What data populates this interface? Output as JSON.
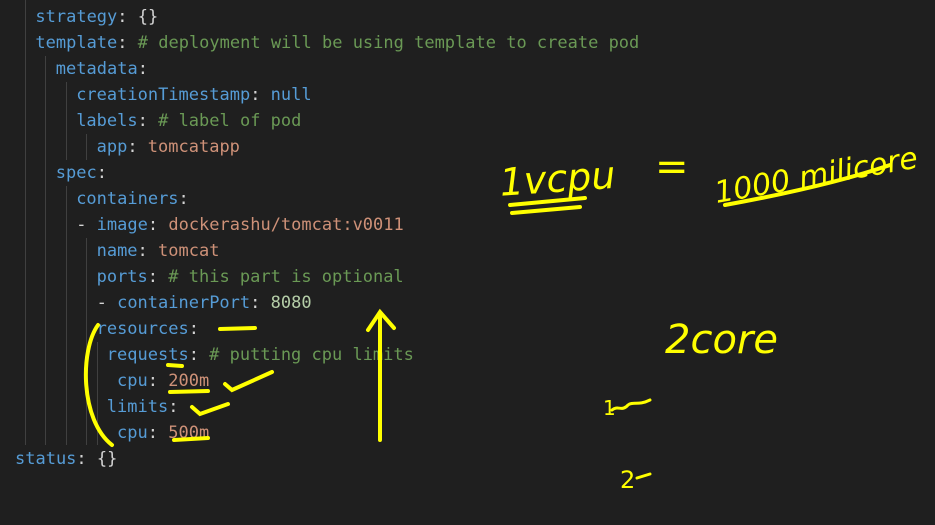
{
  "editor": {
    "lines": [
      {
        "indent": 2,
        "key": "strategy",
        "sep": ": ",
        "value": "{}",
        "value_type": "punct",
        "comment": ""
      },
      {
        "indent": 2,
        "key": "template",
        "sep": ": ",
        "value": "",
        "value_type": "",
        "comment": "# deployment will be using template to create pod"
      },
      {
        "indent": 4,
        "key": "metadata",
        "sep": ":",
        "value": "",
        "value_type": "",
        "comment": ""
      },
      {
        "indent": 6,
        "key": "creationTimestamp",
        "sep": ": ",
        "value": "null",
        "value_type": "kw",
        "comment": ""
      },
      {
        "indent": 6,
        "key": "labels",
        "sep": ": ",
        "value": "",
        "value_type": "",
        "comment": "# label of pod"
      },
      {
        "indent": 8,
        "key": "app",
        "sep": ": ",
        "value": "tomcatapp",
        "value_type": "str",
        "comment": ""
      },
      {
        "indent": 4,
        "key": "spec",
        "sep": ":",
        "value": "",
        "value_type": "",
        "comment": ""
      },
      {
        "indent": 6,
        "key": "containers",
        "sep": ":",
        "value": "",
        "value_type": "",
        "comment": ""
      },
      {
        "indent": 6,
        "dash": "- ",
        "key": "image",
        "sep": ": ",
        "value": "dockerashu/tomcat:v0011",
        "value_type": "str",
        "comment": ""
      },
      {
        "indent": 8,
        "key": "name",
        "sep": ": ",
        "value": "tomcat",
        "value_type": "str",
        "comment": ""
      },
      {
        "indent": 8,
        "key": "ports",
        "sep": ": ",
        "value": "",
        "value_type": "",
        "comment": "# this part is optional"
      },
      {
        "indent": 8,
        "dash": "- ",
        "key": "containerPort",
        "sep": ": ",
        "value": "8080",
        "value_type": "num",
        "comment": ""
      },
      {
        "indent": 8,
        "key": "resources",
        "sep": ":",
        "value": "",
        "value_type": "",
        "comment": ""
      },
      {
        "indent": 9,
        "key": "requests",
        "sep": ": ",
        "value": "",
        "value_type": "",
        "comment": "# putting cpu limits"
      },
      {
        "indent": 9,
        "key": " cpu",
        "sep": ": ",
        "value": "200m",
        "value_type": "str",
        "comment": ""
      },
      {
        "indent": 9,
        "key": "limits",
        "sep": ":",
        "value": "",
        "value_type": "",
        "comment": ""
      },
      {
        "indent": 9,
        "key": " cpu",
        "sep": ": ",
        "value": "500m",
        "value_type": "str",
        "comment": ""
      },
      {
        "indent": 0,
        "key": "status",
        "sep": ": ",
        "value": "{}",
        "value_type": "punct",
        "comment": ""
      }
    ]
  },
  "annotations": {
    "vcpu": "1vcpu",
    "equals": "=",
    "millicore": "1000 milicore",
    "two_core": "2core",
    "one": "1",
    "two": "2"
  },
  "colors": {
    "background": "#1f1f1f",
    "key": "#569cd6",
    "string": "#ce9178",
    "number": "#b5cea8",
    "comment": "#6a9955",
    "annotation": "#ffff00"
  }
}
